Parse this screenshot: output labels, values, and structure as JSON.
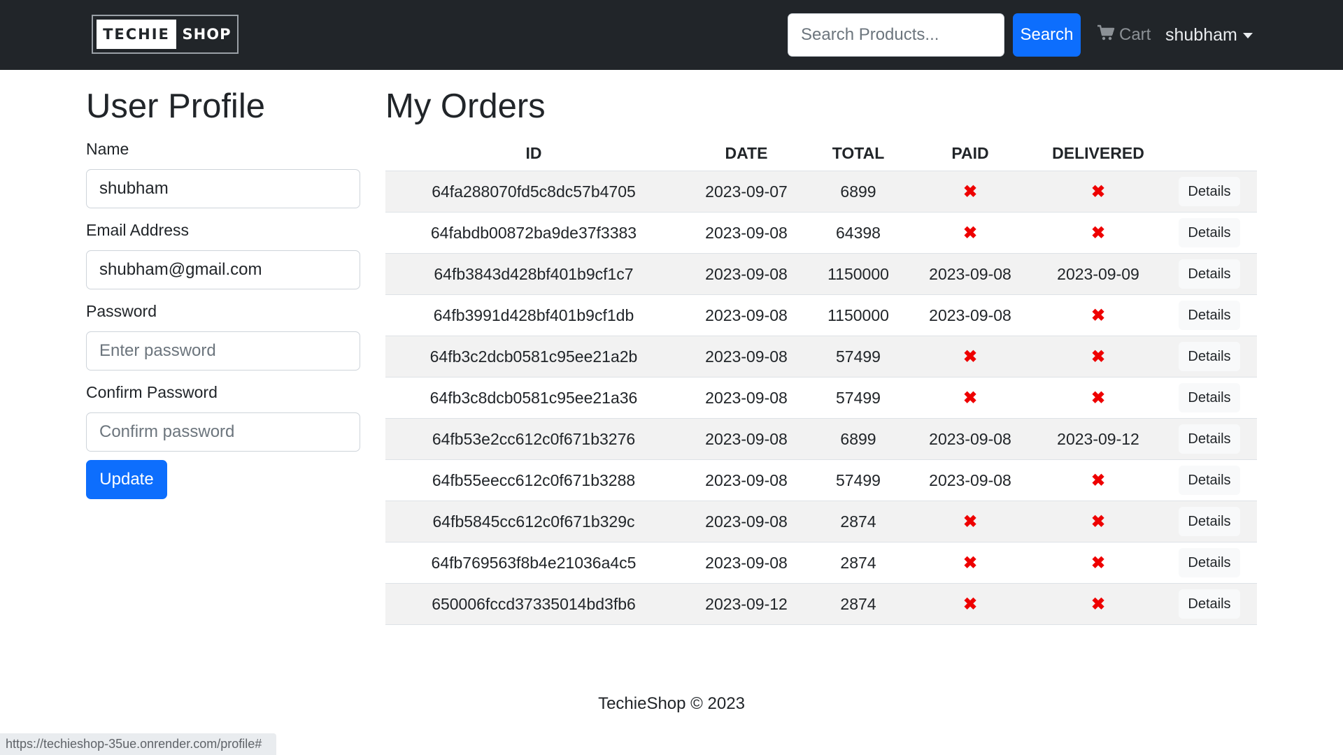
{
  "header": {
    "logo": {
      "left": "TECHIE",
      "right": "SHOP"
    },
    "search": {
      "placeholder": "Search Products...",
      "button_label": "Search"
    },
    "cart_label": "Cart",
    "user_name": "shubham"
  },
  "profile": {
    "title": "User Profile",
    "name_label": "Name",
    "name_value": "shubham",
    "email_label": "Email Address",
    "email_value": "shubham@gmail.com",
    "password_label": "Password",
    "password_placeholder": "Enter password",
    "confirm_label": "Confirm Password",
    "confirm_placeholder": "Confirm password",
    "update_label": "Update"
  },
  "orders": {
    "title": "My Orders",
    "columns": [
      "ID",
      "DATE",
      "TOTAL",
      "PAID",
      "DELIVERED",
      ""
    ],
    "details_label": "Details",
    "rows": [
      {
        "id": "64fa288070fd5c8dc57b4705",
        "date": "2023-09-07",
        "total": "6899",
        "paid": null,
        "delivered": null
      },
      {
        "id": "64fabdb00872ba9de37f3383",
        "date": "2023-09-08",
        "total": "64398",
        "paid": null,
        "delivered": null
      },
      {
        "id": "64fb3843d428bf401b9cf1c7",
        "date": "2023-09-08",
        "total": "1150000",
        "paid": "2023-09-08",
        "delivered": "2023-09-09"
      },
      {
        "id": "64fb3991d428bf401b9cf1db",
        "date": "2023-09-08",
        "total": "1150000",
        "paid": "2023-09-08",
        "delivered": null
      },
      {
        "id": "64fb3c2dcb0581c95ee21a2b",
        "date": "2023-09-08",
        "total": "57499",
        "paid": null,
        "delivered": null
      },
      {
        "id": "64fb3c8dcb0581c95ee21a36",
        "date": "2023-09-08",
        "total": "57499",
        "paid": null,
        "delivered": null
      },
      {
        "id": "64fb53e2cc612c0f671b3276",
        "date": "2023-09-08",
        "total": "6899",
        "paid": "2023-09-08",
        "delivered": "2023-09-12"
      },
      {
        "id": "64fb55eecc612c0f671b3288",
        "date": "2023-09-08",
        "total": "57499",
        "paid": "2023-09-08",
        "delivered": null
      },
      {
        "id": "64fb5845cc612c0f671b329c",
        "date": "2023-09-08",
        "total": "2874",
        "paid": null,
        "delivered": null
      },
      {
        "id": "64fb769563f8b4e21036a4c5",
        "date": "2023-09-08",
        "total": "2874",
        "paid": null,
        "delivered": null
      },
      {
        "id": "650006fccd37335014bd3fb6",
        "date": "2023-09-12",
        "total": "2874",
        "paid": null,
        "delivered": null
      }
    ]
  },
  "icons": {
    "not_done": "x-mark-icon",
    "cart": "cart-icon",
    "caret": "caret-down-icon"
  },
  "colors": {
    "navbar": "#212529",
    "primary": "#0d6efd",
    "x_mark": "#ee0000",
    "stripe": "#f2f2f2"
  },
  "footer": {
    "text": "TechieShop © 2023"
  },
  "status_bar": {
    "url": "https://techieshop-35ue.onrender.com/profile#"
  }
}
